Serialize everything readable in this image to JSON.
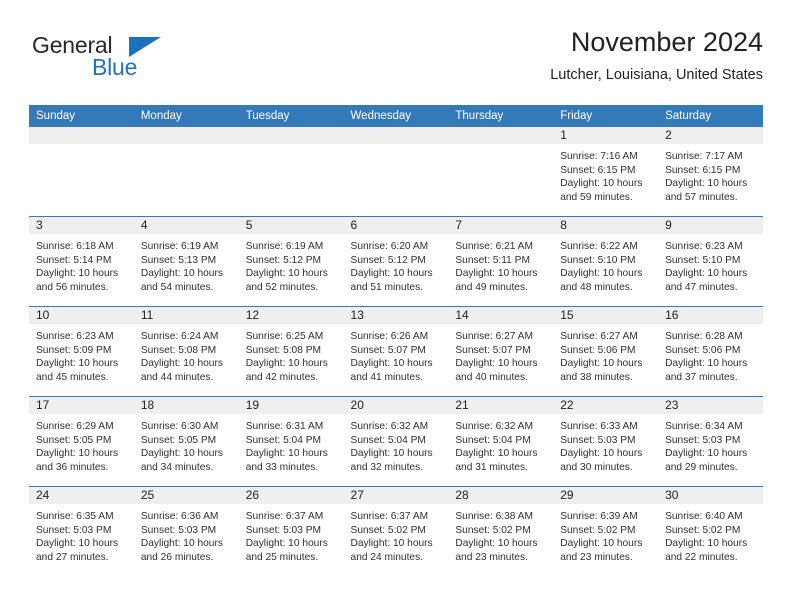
{
  "brand": {
    "name_top": "General",
    "name_bottom": "Blue",
    "accent_color": "#2272b8"
  },
  "header": {
    "title": "November 2024",
    "subtitle": "Lutcher, Louisiana, United States"
  },
  "calendar": {
    "header_bg": "#3479b8",
    "daynum_bg": "#efeff0",
    "weekdays": [
      "Sunday",
      "Monday",
      "Tuesday",
      "Wednesday",
      "Thursday",
      "Friday",
      "Saturday"
    ],
    "weeks": [
      [
        {
          "day": "",
          "lines": []
        },
        {
          "day": "",
          "lines": []
        },
        {
          "day": "",
          "lines": []
        },
        {
          "day": "",
          "lines": []
        },
        {
          "day": "",
          "lines": []
        },
        {
          "day": "1",
          "lines": [
            "Sunrise: 7:16 AM",
            "Sunset: 6:15 PM",
            "Daylight: 10 hours and 59 minutes."
          ]
        },
        {
          "day": "2",
          "lines": [
            "Sunrise: 7:17 AM",
            "Sunset: 6:15 PM",
            "Daylight: 10 hours and 57 minutes."
          ]
        }
      ],
      [
        {
          "day": "3",
          "lines": [
            "Sunrise: 6:18 AM",
            "Sunset: 5:14 PM",
            "Daylight: 10 hours and 56 minutes."
          ]
        },
        {
          "day": "4",
          "lines": [
            "Sunrise: 6:19 AM",
            "Sunset: 5:13 PM",
            "Daylight: 10 hours and 54 minutes."
          ]
        },
        {
          "day": "5",
          "lines": [
            "Sunrise: 6:19 AM",
            "Sunset: 5:12 PM",
            "Daylight: 10 hours and 52 minutes."
          ]
        },
        {
          "day": "6",
          "lines": [
            "Sunrise: 6:20 AM",
            "Sunset: 5:12 PM",
            "Daylight: 10 hours and 51 minutes."
          ]
        },
        {
          "day": "7",
          "lines": [
            "Sunrise: 6:21 AM",
            "Sunset: 5:11 PM",
            "Daylight: 10 hours and 49 minutes."
          ]
        },
        {
          "day": "8",
          "lines": [
            "Sunrise: 6:22 AM",
            "Sunset: 5:10 PM",
            "Daylight: 10 hours and 48 minutes."
          ]
        },
        {
          "day": "9",
          "lines": [
            "Sunrise: 6:23 AM",
            "Sunset: 5:10 PM",
            "Daylight: 10 hours and 47 minutes."
          ]
        }
      ],
      [
        {
          "day": "10",
          "lines": [
            "Sunrise: 6:23 AM",
            "Sunset: 5:09 PM",
            "Daylight: 10 hours and 45 minutes."
          ]
        },
        {
          "day": "11",
          "lines": [
            "Sunrise: 6:24 AM",
            "Sunset: 5:08 PM",
            "Daylight: 10 hours and 44 minutes."
          ]
        },
        {
          "day": "12",
          "lines": [
            "Sunrise: 6:25 AM",
            "Sunset: 5:08 PM",
            "Daylight: 10 hours and 42 minutes."
          ]
        },
        {
          "day": "13",
          "lines": [
            "Sunrise: 6:26 AM",
            "Sunset: 5:07 PM",
            "Daylight: 10 hours and 41 minutes."
          ]
        },
        {
          "day": "14",
          "lines": [
            "Sunrise: 6:27 AM",
            "Sunset: 5:07 PM",
            "Daylight: 10 hours and 40 minutes."
          ]
        },
        {
          "day": "15",
          "lines": [
            "Sunrise: 6:27 AM",
            "Sunset: 5:06 PM",
            "Daylight: 10 hours and 38 minutes."
          ]
        },
        {
          "day": "16",
          "lines": [
            "Sunrise: 6:28 AM",
            "Sunset: 5:06 PM",
            "Daylight: 10 hours and 37 minutes."
          ]
        }
      ],
      [
        {
          "day": "17",
          "lines": [
            "Sunrise: 6:29 AM",
            "Sunset: 5:05 PM",
            "Daylight: 10 hours and 36 minutes."
          ]
        },
        {
          "day": "18",
          "lines": [
            "Sunrise: 6:30 AM",
            "Sunset: 5:05 PM",
            "Daylight: 10 hours and 34 minutes."
          ]
        },
        {
          "day": "19",
          "lines": [
            "Sunrise: 6:31 AM",
            "Sunset: 5:04 PM",
            "Daylight: 10 hours and 33 minutes."
          ]
        },
        {
          "day": "20",
          "lines": [
            "Sunrise: 6:32 AM",
            "Sunset: 5:04 PM",
            "Daylight: 10 hours and 32 minutes."
          ]
        },
        {
          "day": "21",
          "lines": [
            "Sunrise: 6:32 AM",
            "Sunset: 5:04 PM",
            "Daylight: 10 hours and 31 minutes."
          ]
        },
        {
          "day": "22",
          "lines": [
            "Sunrise: 6:33 AM",
            "Sunset: 5:03 PM",
            "Daylight: 10 hours and 30 minutes."
          ]
        },
        {
          "day": "23",
          "lines": [
            "Sunrise: 6:34 AM",
            "Sunset: 5:03 PM",
            "Daylight: 10 hours and 29 minutes."
          ]
        }
      ],
      [
        {
          "day": "24",
          "lines": [
            "Sunrise: 6:35 AM",
            "Sunset: 5:03 PM",
            "Daylight: 10 hours and 27 minutes."
          ]
        },
        {
          "day": "25",
          "lines": [
            "Sunrise: 6:36 AM",
            "Sunset: 5:03 PM",
            "Daylight: 10 hours and 26 minutes."
          ]
        },
        {
          "day": "26",
          "lines": [
            "Sunrise: 6:37 AM",
            "Sunset: 5:03 PM",
            "Daylight: 10 hours and 25 minutes."
          ]
        },
        {
          "day": "27",
          "lines": [
            "Sunrise: 6:37 AM",
            "Sunset: 5:02 PM",
            "Daylight: 10 hours and 24 minutes."
          ]
        },
        {
          "day": "28",
          "lines": [
            "Sunrise: 6:38 AM",
            "Sunset: 5:02 PM",
            "Daylight: 10 hours and 23 minutes."
          ]
        },
        {
          "day": "29",
          "lines": [
            "Sunrise: 6:39 AM",
            "Sunset: 5:02 PM",
            "Daylight: 10 hours and 23 minutes."
          ]
        },
        {
          "day": "30",
          "lines": [
            "Sunrise: 6:40 AM",
            "Sunset: 5:02 PM",
            "Daylight: 10 hours and 22 minutes."
          ]
        }
      ]
    ]
  }
}
